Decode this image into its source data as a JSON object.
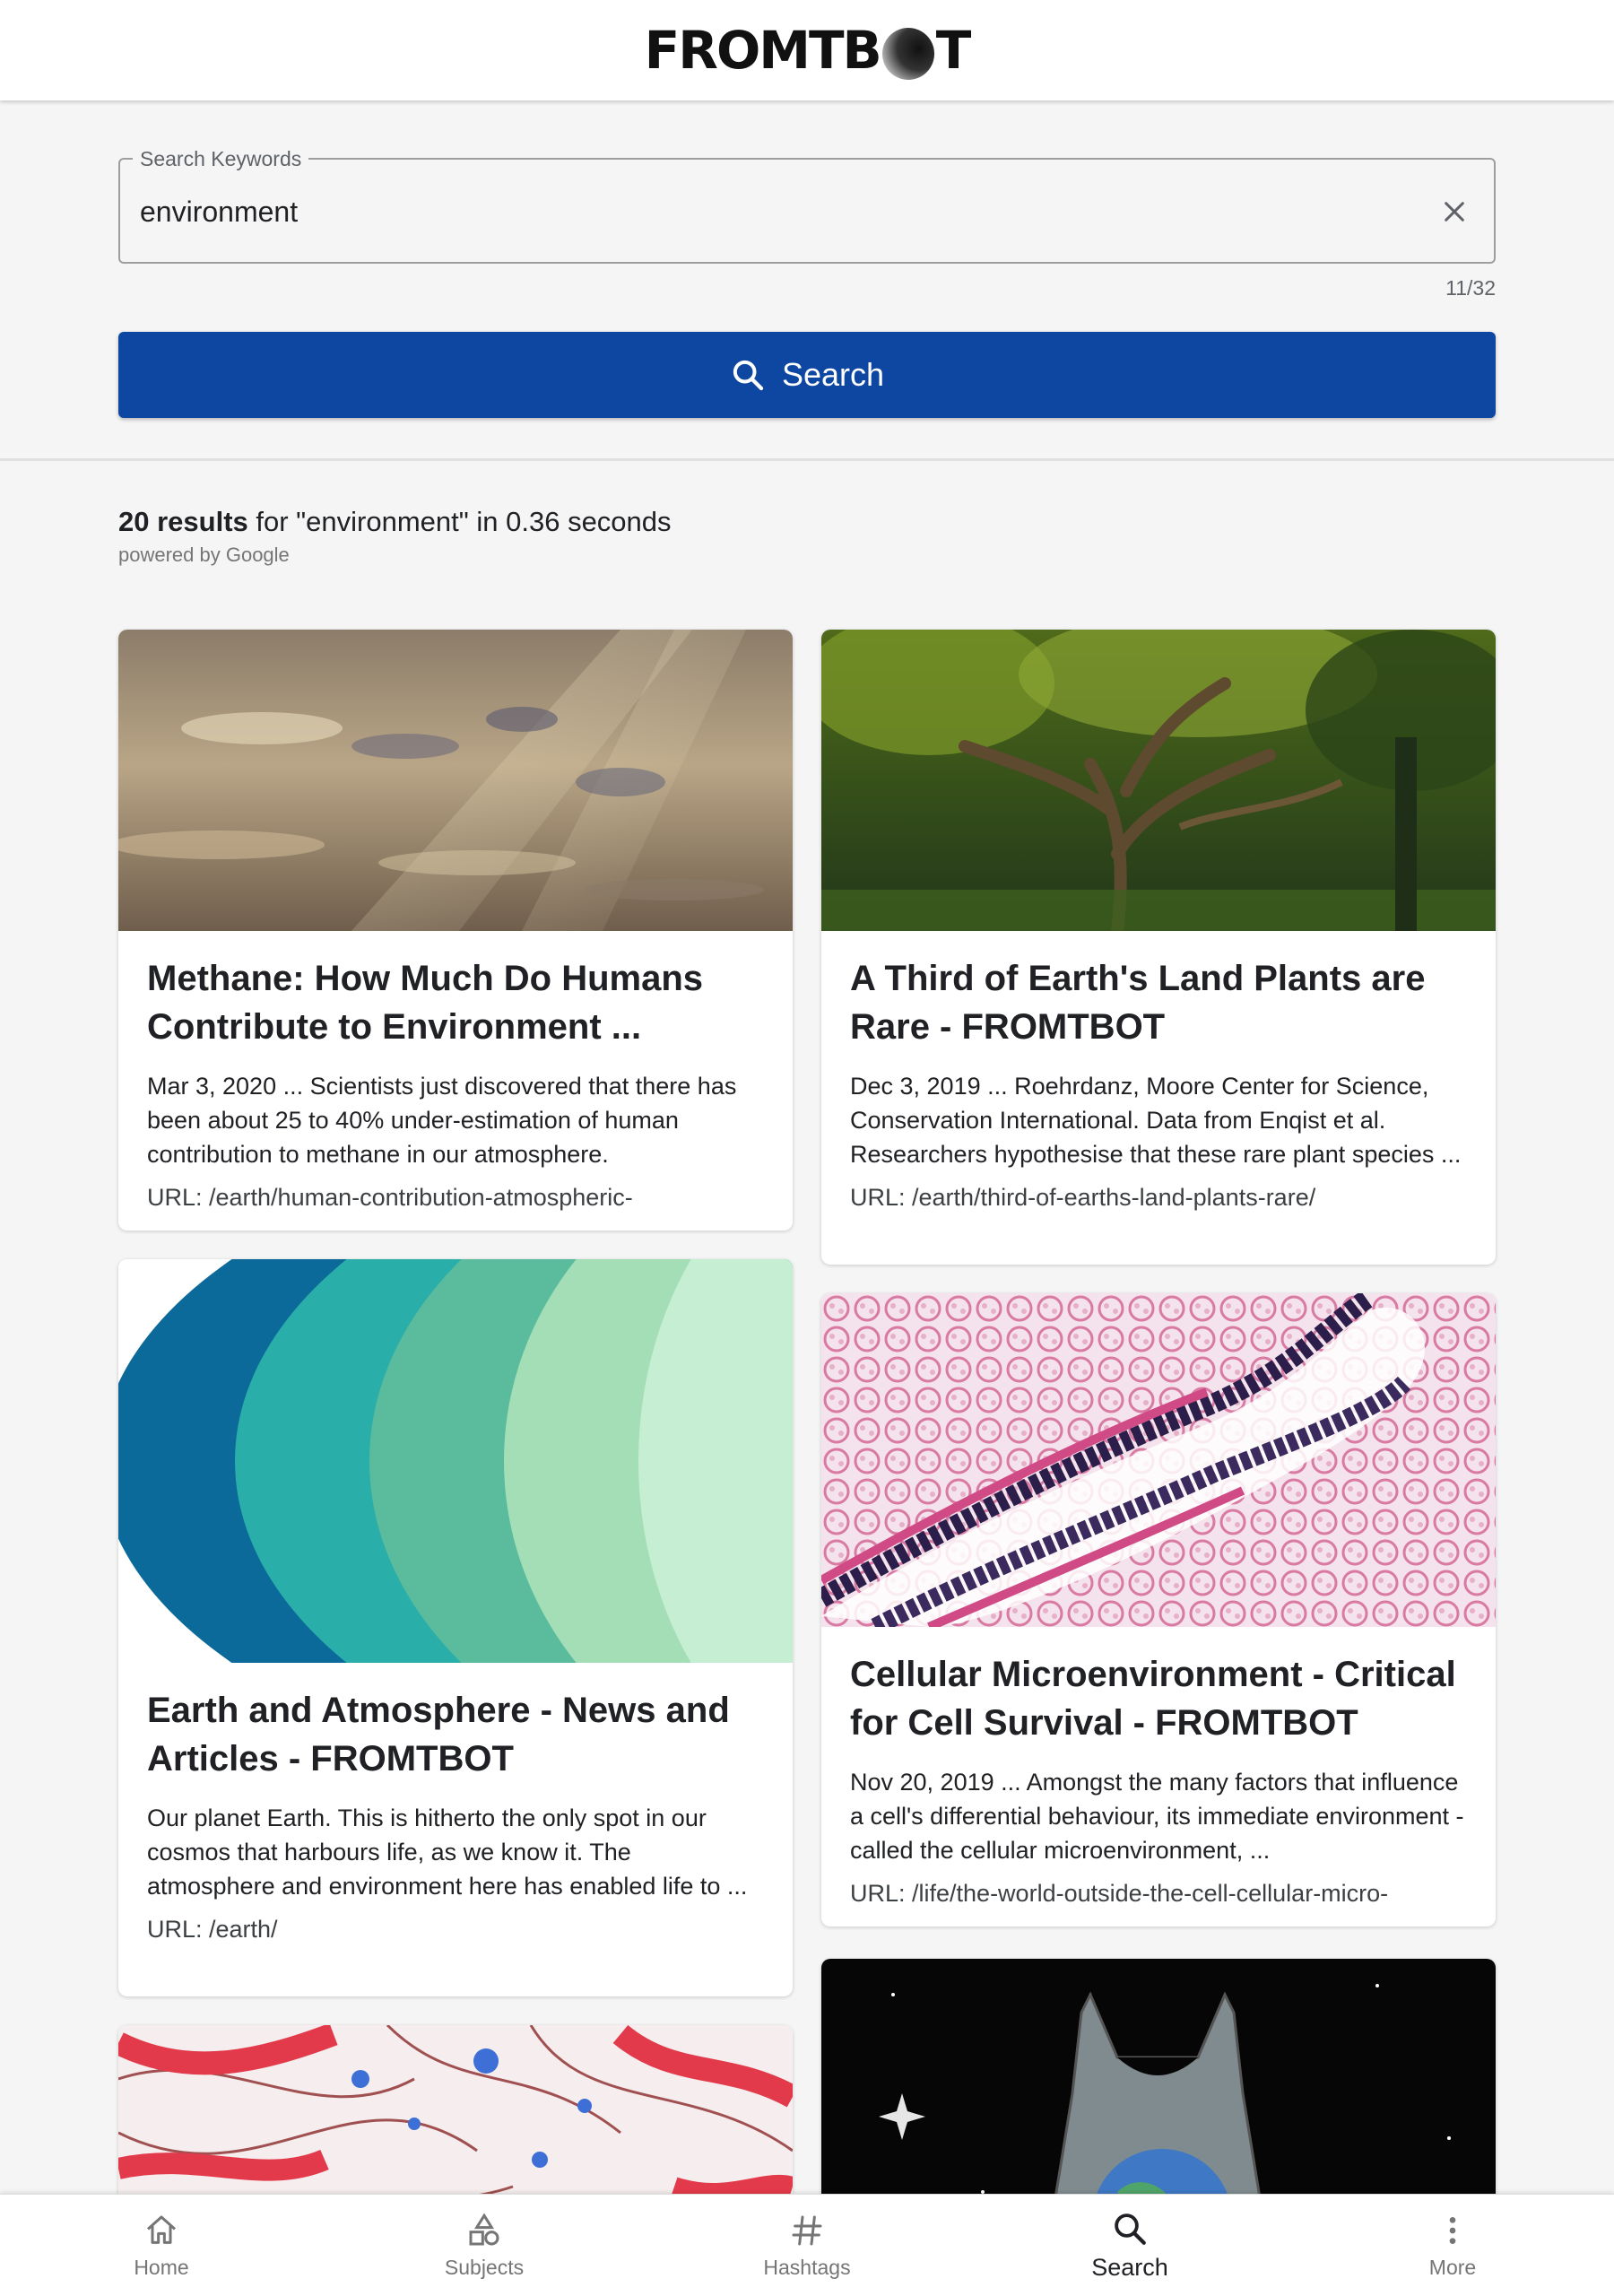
{
  "app": {
    "logo_left": "FROMTB",
    "logo_right": "T"
  },
  "search": {
    "label": "Search Keywords",
    "value": "environment",
    "counter": "11/32",
    "button_label": "Search"
  },
  "results": {
    "count_text": "20 results",
    "query_text": " for \"environment\" in 0.36 seconds",
    "powered_by": "powered by Google"
  },
  "cards": [
    {
      "title": "Methane: How Much Do Humans Contribute to Environment ...",
      "snippet": "Mar 3, 2020 ... Scientists just discovered that there has been about 25 to 40% under-estimation of human contribution to methane in our atmosphere.",
      "url": "URL: /earth/human-contribution-atmospheric-"
    },
    {
      "title": "A Third of Earth's Land Plants are Rare - FROMTBOT",
      "snippet": "Dec 3, 2019 ... Roehrdanz, Moore Center for Science, Conservation International. Data from Enqist et al. Researchers hypothesise that these rare plant species ...",
      "url": "URL: /earth/third-of-earths-land-plants-rare/"
    },
    {
      "title": "Earth and Atmosphere - News and Articles - FROMTBOT",
      "snippet": "Our planet Earth. This is hitherto the only spot in our cosmos that harbours life, as we know it. The atmosphere and environment here has enabled life to ...",
      "url": "URL: /earth/"
    },
    {
      "title": "Cellular Microenvironment - Critical for Cell Survival - FROMTBOT",
      "snippet": "Nov 20, 2019 ... Amongst the many factors that influence a cell's differential behaviour, its immediate environment - called the cellular microenvironment, ...",
      "url": "URL: /life/the-world-outside-the-cell-cellular-micro-"
    }
  ],
  "nav": [
    {
      "label": "Home",
      "icon": "home-icon"
    },
    {
      "label": "Subjects",
      "icon": "shapes-icon"
    },
    {
      "label": "Hashtags",
      "icon": "hashtag-icon"
    },
    {
      "label": "Search",
      "icon": "search-icon",
      "active": true
    },
    {
      "label": "More",
      "icon": "more-vertical-icon"
    }
  ],
  "colors": {
    "primary": "#0d47a1",
    "background": "#f5f5f5"
  }
}
